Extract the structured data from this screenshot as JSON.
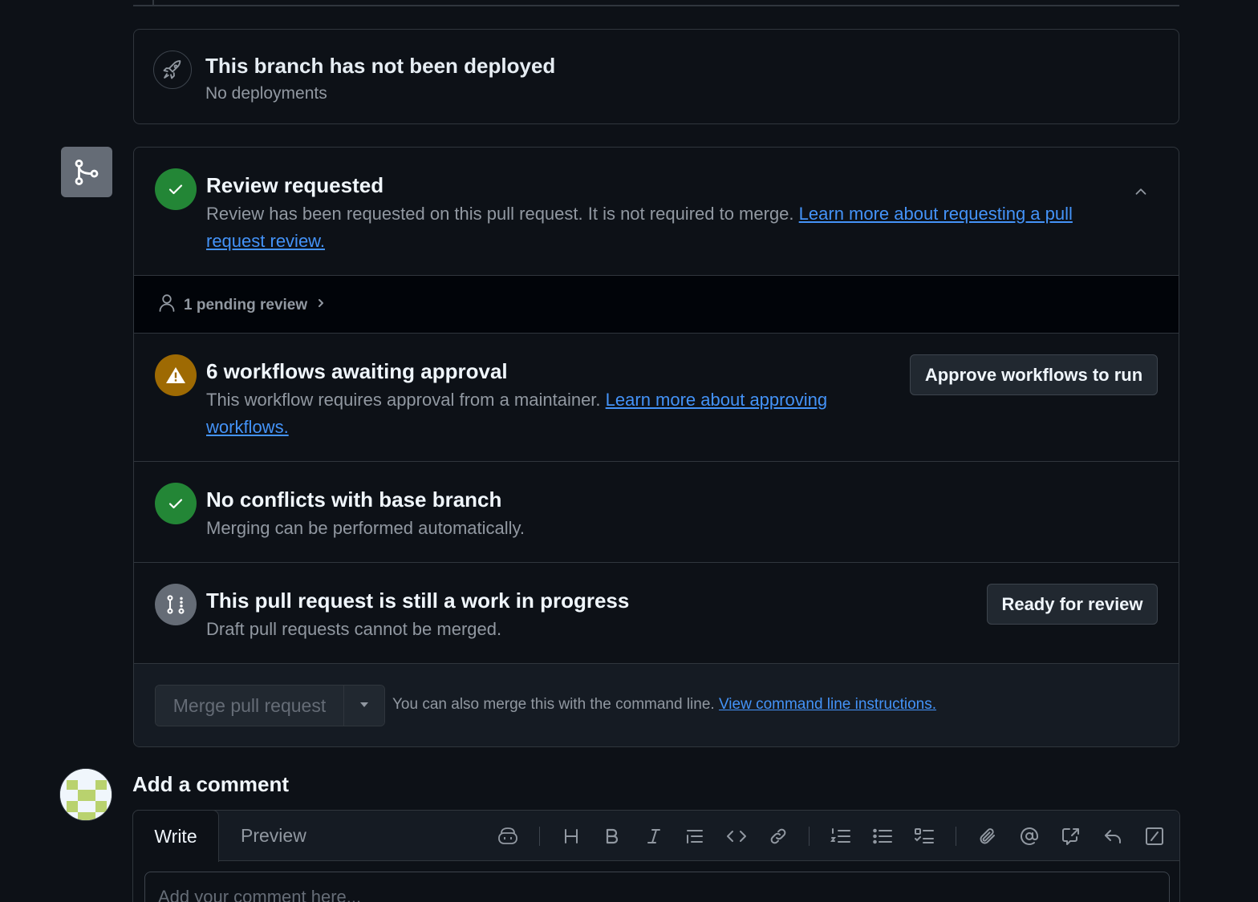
{
  "deploy": {
    "title": "This branch has not been deployed",
    "subtitle": "No deployments",
    "icon": "rocket-icon"
  },
  "review": {
    "title": "Review requested",
    "desc_text": "Review has been requested on this pull request. It is not required to merge. ",
    "link_text": "Learn more about requesting a pull request review.",
    "status_color": "#238636"
  },
  "pending": {
    "label": "1 pending review"
  },
  "workflows": {
    "title": "6 workflows awaiting approval",
    "desc_text": "This workflow requires approval from a maintainer. ",
    "link_text": "Learn more about approving workflows.",
    "button": "Approve workflows to run",
    "status_color": "#9e6a03"
  },
  "conflicts": {
    "title": "No conflicts with base branch",
    "desc": "Merging can be performed automatically."
  },
  "wip": {
    "title": "This pull request is still a work in progress",
    "desc": "Draft pull requests cannot be merged.",
    "button": "Ready for review"
  },
  "merge": {
    "button": "Merge pull request",
    "hint_text": "You can also merge this with the command line. ",
    "link_text": "View command line instructions."
  },
  "comment": {
    "heading": "Add a comment",
    "tab_write": "Write",
    "tab_preview": "Preview",
    "placeholder": "Add your comment here..."
  },
  "colors": {
    "accent_link": "#4493f8",
    "success": "#238636",
    "attention": "#9e6a03",
    "background": "#0d1117"
  }
}
